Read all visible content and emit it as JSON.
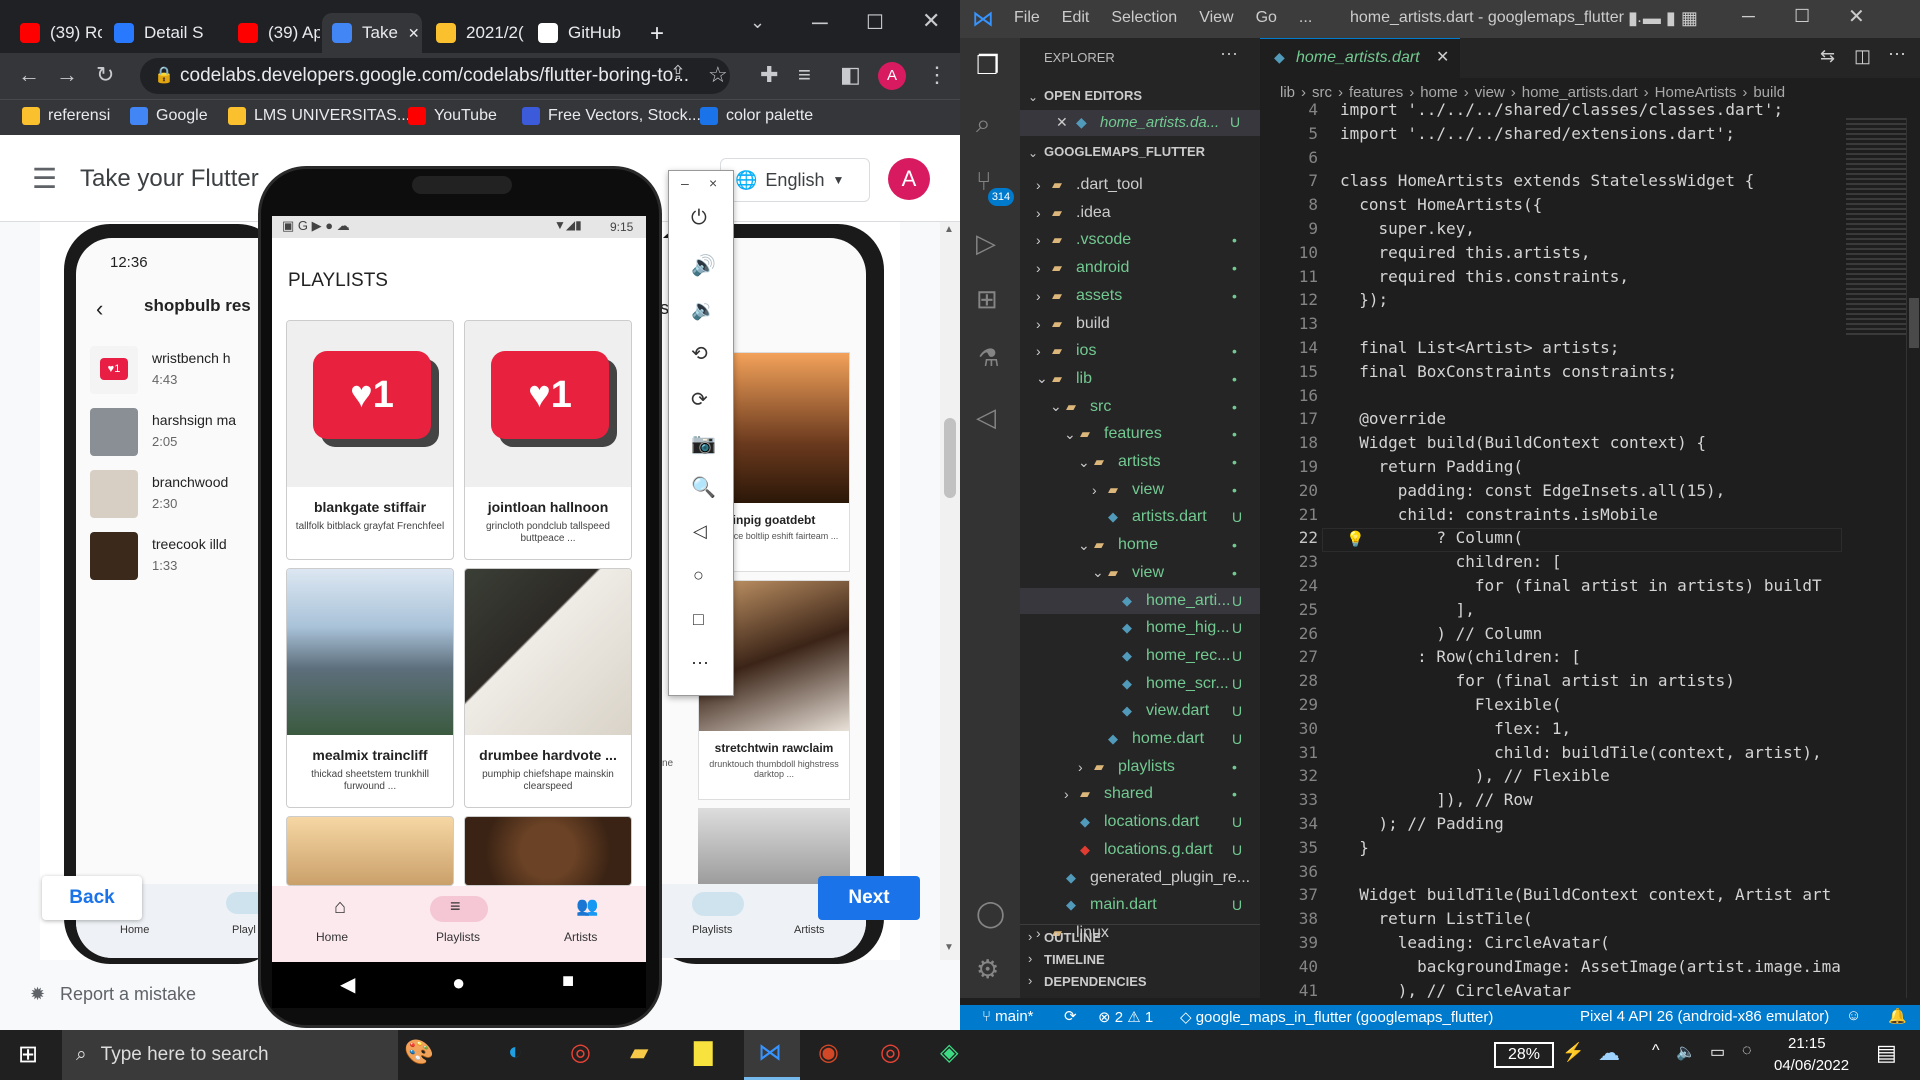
{
  "chrome": {
    "tabs": [
      {
        "label": "(39) Ro",
        "color": "#ff0000"
      },
      {
        "label": "Detail S",
        "color": "#2979ff"
      },
      {
        "label": "(39) Ap",
        "color": "#ff0000"
      },
      {
        "label": "Take",
        "color": "#4285f4"
      },
      {
        "label": "2021/2(",
        "color": "#fbc02d"
      },
      {
        "label": "GitHub",
        "color": "#ffffff"
      }
    ],
    "url": "codelabs.developers.google.com/codelabs/flutter-boring-to...",
    "bookmarks": [
      {
        "label": "referensi",
        "color": "#fbc02d"
      },
      {
        "label": "Google",
        "color": "#4285f4"
      },
      {
        "label": "LMS UNIVERSITAS...",
        "color": "#fbc02d"
      },
      {
        "label": "YouTube",
        "color": "#ff0000"
      },
      {
        "label": "Free Vectors, Stock...",
        "color": "#3b5bdb"
      },
      {
        "label": "color palette",
        "color": "#1a73e8"
      }
    ],
    "profile_letter": "A"
  },
  "codelab": {
    "title": "Take your Flutter",
    "language": "English",
    "avatar": "A",
    "back_label": "Back",
    "next_label": "Next",
    "report": "Report a mistake"
  },
  "bg_phone": {
    "time": "12:36",
    "header": "shopbulb res",
    "songs": [
      {
        "title": "wristbench h",
        "dur": "4:43"
      },
      {
        "title": "harshsign ma",
        "dur": "2:05"
      },
      {
        "title": "branchwood",
        "dur": "2:30"
      },
      {
        "title": "treecook illd",
        "dur": "1:33"
      }
    ],
    "nav": [
      "Home",
      "Playl"
    ]
  },
  "right_phone": {
    "tiles": [
      {
        "title": "inpig goatdebt",
        "sub": "instance boltlip eshift fairteam ..."
      },
      {
        "title": "stretchtwin rawclaim",
        "sub": "drunktouch thumbdoll highstress darktop ..."
      }
    ],
    "partial": "ne",
    "nav": [
      "Playlists",
      "Artists"
    ],
    "s_letter": "s"
  },
  "emulator": {
    "status_time": "9:15",
    "heading": "PLAYLISTS",
    "playlists": [
      {
        "title": "blankgate stiffair",
        "sub": "tallfolk bitblack grayfat Frenchfeel"
      },
      {
        "title": "jointloan hallnoon",
        "sub": "grincloth pondclub tallspeed buttpeace ..."
      },
      {
        "title": "mealmix traincliff",
        "sub": "thickad sheetstem trunkhill furwound ..."
      },
      {
        "title": "drumbee hardvote ...",
        "sub": "pumphip chiefshape mainskin clearspeed"
      }
    ],
    "nav": [
      "Home",
      "Playlists",
      "Artists"
    ]
  },
  "vscode": {
    "menu": [
      "File",
      "Edit",
      "Selection",
      "View",
      "Go",
      "..."
    ],
    "title": "home_artists.dart - googlemaps_flutter ...",
    "explorer": "EXPLORER",
    "open_editors": "OPEN EDITORS",
    "open_file": "home_artists.da...",
    "open_file_status": "U",
    "project": "GOOGLEMAPS_FLUTTER",
    "tab": "home_artists.dart",
    "breadcrumb": [
      "lib",
      "src",
      "features",
      "home",
      "view",
      "home_artists.dart",
      "HomeArtists",
      "build"
    ],
    "scm_badge": "314",
    "tree": [
      {
        "name": ".dart_tool",
        "depth": 0,
        "kind": "folder",
        "status": ""
      },
      {
        "name": ".idea",
        "depth": 0,
        "kind": "folder",
        "status": ""
      },
      {
        "name": ".vscode",
        "depth": 0,
        "kind": "folder",
        "status": "•"
      },
      {
        "name": "android",
        "depth": 0,
        "kind": "folder",
        "status": "•"
      },
      {
        "name": "assets",
        "depth": 0,
        "kind": "folder",
        "status": "•"
      },
      {
        "name": "build",
        "depth": 0,
        "kind": "folder",
        "status": ""
      },
      {
        "name": "ios",
        "depth": 0,
        "kind": "folder",
        "status": "•"
      },
      {
        "name": "lib",
        "depth": 0,
        "kind": "folder-open",
        "status": "•"
      },
      {
        "name": "src",
        "depth": 1,
        "kind": "folder-open",
        "status": "•"
      },
      {
        "name": "features",
        "depth": 2,
        "kind": "folder-open",
        "status": "•"
      },
      {
        "name": "artists",
        "depth": 3,
        "kind": "folder-open",
        "status": "•"
      },
      {
        "name": "view",
        "depth": 4,
        "kind": "folder",
        "status": "•"
      },
      {
        "name": "artists.dart",
        "depth": 4,
        "kind": "file",
        "status": "U"
      },
      {
        "name": "home",
        "depth": 3,
        "kind": "folder-open",
        "status": "•"
      },
      {
        "name": "view",
        "depth": 4,
        "kind": "folder-open",
        "status": "•"
      },
      {
        "name": "home_arti...",
        "depth": 5,
        "kind": "file",
        "status": "U"
      },
      {
        "name": "home_hig...",
        "depth": 5,
        "kind": "file",
        "status": "U"
      },
      {
        "name": "home_rec...",
        "depth": 5,
        "kind": "file",
        "status": "U"
      },
      {
        "name": "home_scr...",
        "depth": 5,
        "kind": "file",
        "status": "U"
      },
      {
        "name": "view.dart",
        "depth": 5,
        "kind": "file",
        "status": "U"
      },
      {
        "name": "home.dart",
        "depth": 4,
        "kind": "file",
        "status": "U"
      },
      {
        "name": "playlists",
        "depth": 3,
        "kind": "folder",
        "status": "•"
      },
      {
        "name": "shared",
        "depth": 2,
        "kind": "folder",
        "status": "•"
      },
      {
        "name": "locations.dart",
        "depth": 2,
        "kind": "file",
        "status": "U"
      },
      {
        "name": "locations.g.dart",
        "depth": 2,
        "kind": "file-red",
        "status": "U"
      },
      {
        "name": "generated_plugin_re...",
        "depth": 1,
        "kind": "file",
        "status": ""
      },
      {
        "name": "main.dart",
        "depth": 1,
        "kind": "file",
        "status": "U"
      },
      {
        "name": "linux",
        "depth": 0,
        "kind": "folder",
        "status": ""
      }
    ],
    "panels": [
      "OUTLINE",
      "TIMELINE",
      "DEPENDENCIES"
    ],
    "line_numbers": [
      "4",
      "5",
      "6",
      "7",
      "8",
      "9",
      "10",
      "11",
      "12",
      "13",
      "14",
      "15",
      "16",
      "17",
      "18",
      "19",
      "20",
      "21",
      "22",
      "23",
      "24",
      "25",
      "26",
      "27",
      "28",
      "29",
      "30",
      "31",
      "32",
      "33",
      "34",
      "35",
      "36",
      "37",
      "38",
      "39",
      "40",
      "41"
    ],
    "code_lines": [
      "import '../../../shared/classes/classes.dart';",
      "import '../../../shared/extensions.dart';",
      "",
      "class HomeArtists extends StatelessWidget {",
      "  const HomeArtists({",
      "    super.key,",
      "    required this.artists,",
      "    required this.constraints,",
      "  });",
      "",
      "  final List<Artist> artists;",
      "  final BoxConstraints constraints;",
      "",
      "  @override",
      "  Widget build(BuildContext context) {",
      "    return Padding(",
      "      padding: const EdgeInsets.all(15),",
      "      child: constraints.isMobile",
      "          ? Column(",
      "            children: [",
      "              for (final artist in artists) buildT",
      "            ],",
      "          ) // Column",
      "        : Row(children: [",
      "            for (final artist in artists)",
      "              Flexible(",
      "                flex: 1,",
      "                child: buildTile(context, artist),",
      "              ), // Flexible",
      "          ]), // Row",
      "    ); // Padding",
      "  }",
      "",
      "  Widget buildTile(BuildContext context, Artist art",
      "    return ListTile(",
      "      leading: CircleAvatar(",
      "        backgroundImage: AssetImage(artist.image.ima",
      "      ), // CircleAvatar"
    ],
    "status": {
      "branch": "main*",
      "errors": "⊗ 2 ⚠ 1",
      "project": "google_maps_in_flutter (googlemaps_flutter)",
      "device": "Pixel 4 API 26 (android-x86 emulator)"
    }
  },
  "taskbar": {
    "search_placeholder": "Type here to search",
    "battery": "28%",
    "time": "21:15",
    "date": "04/06/2022"
  }
}
